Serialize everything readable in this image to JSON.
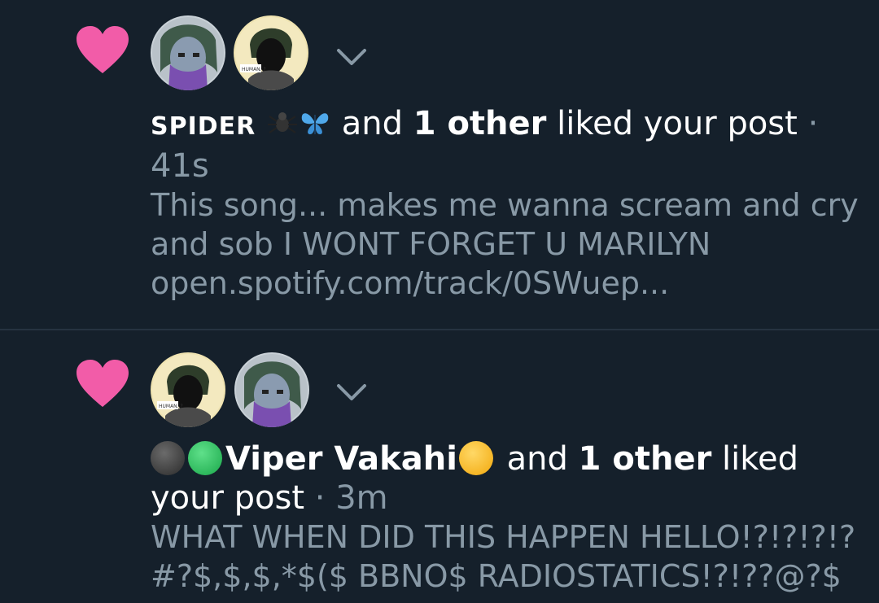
{
  "notifications": [
    {
      "users": [
        "SPIDER"
      ],
      "action_text": "and",
      "others_text": "1 other",
      "action_suffix": "liked your post",
      "separator": "·",
      "time": "41s",
      "post_text_line1": "This song... makes me wanna scream and cry",
      "post_text_line2": "and sob I WONT FORGET U MARILYN",
      "post_text_line3": "open.spotify.com/track/0SWuep...",
      "emoji_icons": [
        "spider-icon",
        "butterfly-icon"
      ]
    },
    {
      "users": [
        "Viper Vakahi"
      ],
      "action_text": "and",
      "others_text": "1 other",
      "action_suffix_1": "liked",
      "action_suffix_2": "your post",
      "separator": "·",
      "time": "3m",
      "post_text_line1": "WHAT WHEN DID THIS HAPPEN HELLO!?!?!?!?",
      "post_text_line2": "#?$,$,$,*$($ BBNO$ RADIOSTATICS!?!??@?$",
      "emoji_icons": [
        "black-circle-icon",
        "green-circle-icon",
        "yellow-circle-icon"
      ]
    }
  ],
  "colors": {
    "background": "#15202b",
    "heart": "#f25ca8",
    "secondary_text": "#8899a6",
    "primary_text": "#ffffff",
    "divider": "#263340"
  }
}
